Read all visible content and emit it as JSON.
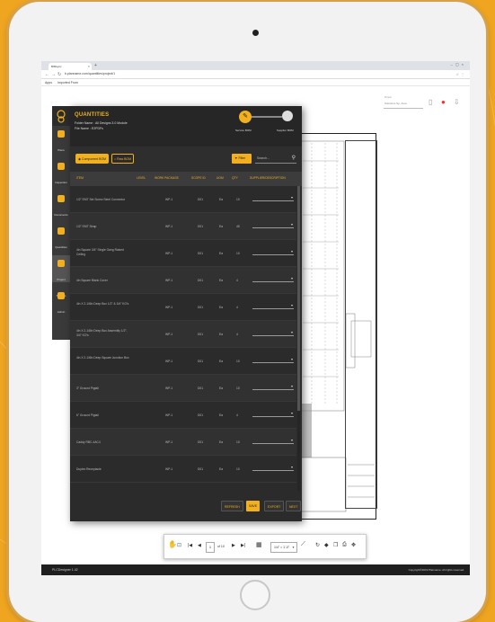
{
  "browser": {
    "tab_title": "BIMsync",
    "url": "b.planname.com/quantities/project/1",
    "bookmarks": [
      "Apps",
      "Imported From"
    ]
  },
  "app_toolbar": {
    "project_label": "Project",
    "project_value": "Solutions Sp. Area"
  },
  "sidebar": {
    "items": [
      {
        "label": "Plans",
        "icon": "plans-icon",
        "active": false
      },
      {
        "label": "Inspection",
        "icon": "inspection-icon",
        "active": false
      },
      {
        "label": "Documents",
        "icon": "documents-icon",
        "active": false
      },
      {
        "label": "Quantities",
        "icon": "quantities-icon",
        "active": false
      },
      {
        "label": "Project Settings",
        "icon": "settings-icon",
        "active": true
      },
      {
        "label": "Admin",
        "icon": "admin-icon",
        "active": false
      }
    ]
  },
  "panel": {
    "title": "QUANTITIES",
    "folder_line": "Folder Name : All Designs 3.0 Module",
    "file_line": "File Name : E2PDFs",
    "steps": [
      {
        "label": "Service BOM",
        "state": "active"
      },
      {
        "label": "Supplier BOM",
        "state": "pending"
      }
    ],
    "chips": [
      {
        "label": "Component BOM",
        "selected": true
      },
      {
        "label": "Raw BOM",
        "selected": false
      }
    ],
    "filter_label": "Filter",
    "search_placeholder": "Search..."
  },
  "table": {
    "columns": [
      "ITEM",
      "LEVEL",
      "WORK PACKAGE",
      "SCOPE ID",
      "UOM",
      "QTY",
      "SUPPLIER/DESCRIPTION"
    ],
    "rows": [
      {
        "item": "1/2\" EMT Set Screw Steel Connector",
        "level": "",
        "wp": "WP-1",
        "scope": "D01",
        "uom": "Ea",
        "qty": "10",
        "supplier": ""
      },
      {
        "item": "1/2\" EMT Strap",
        "level": "",
        "wp": "WP-1",
        "scope": "D01",
        "uom": "Ea",
        "qty": "45",
        "supplier": ""
      },
      {
        "item": "4in Square 3/4\" Single Gang Raised Ceiling",
        "level": "",
        "wp": "WP-1",
        "scope": "D01",
        "uom": "Ea",
        "qty": "10",
        "supplier": ""
      },
      {
        "item": "4in Square Blank Cover",
        "level": "",
        "wp": "WP-1",
        "scope": "D01",
        "uom": "Ea",
        "qty": "4",
        "supplier": ""
      },
      {
        "item": "4in X 2-1/8in Deep Box 1/2\" & 3/4\" KO's",
        "level": "",
        "wp": "WP-1",
        "scope": "D01",
        "uom": "Ea",
        "qty": "4",
        "supplier": ""
      },
      {
        "item": "4in X 2-1/8in Deep Box Assembly 1/2\", 3/4\" KO's",
        "level": "",
        "wp": "WP-1",
        "scope": "D01",
        "uom": "Ea",
        "qty": "4",
        "supplier": ""
      },
      {
        "item": "4in X 2-1/8in Deep Square Junction Box",
        "level": "",
        "wp": "WP-1",
        "scope": "D01",
        "uom": "Ea",
        "qty": "10",
        "supplier": ""
      },
      {
        "item": "3\" Ground Pigtail",
        "level": "",
        "wp": "WP-1",
        "scope": "D01",
        "uom": "Ea",
        "qty": "10",
        "supplier": ""
      },
      {
        "item": "6\" Ground Pigtail",
        "level": "",
        "wp": "WP-1",
        "scope": "D01",
        "uom": "Ea",
        "qty": "4",
        "supplier": ""
      },
      {
        "item": "Caddy RBC-4AC4",
        "level": "",
        "wp": "WP-1",
        "scope": "D01",
        "uom": "Ea",
        "qty": "10",
        "supplier": ""
      },
      {
        "item": "Duplex Receptacle",
        "level": "",
        "wp": "WP-1",
        "scope": "D01",
        "uom": "Ea",
        "qty": "10",
        "supplier": ""
      }
    ]
  },
  "footer": {
    "buttons": [
      {
        "label": "REFRESH",
        "style": "dark"
      },
      {
        "label": "SAVE",
        "style": "gold"
      },
      {
        "label": "EXPORT",
        "style": "dark"
      },
      {
        "label": "NEXT",
        "style": "dark"
      }
    ]
  },
  "viewer": {
    "page_current": "1",
    "page_total": "of 10",
    "zoom": "1/4\" = 1'-0\""
  },
  "status": {
    "left": "PLCDesigner 1.42",
    "right": "Copyright©2019 Planname. All rights reserved."
  },
  "colors": {
    "accent": "#f2b01e",
    "panel_bg": "#2b2b2b",
    "frame_bg": "#f0a520"
  }
}
